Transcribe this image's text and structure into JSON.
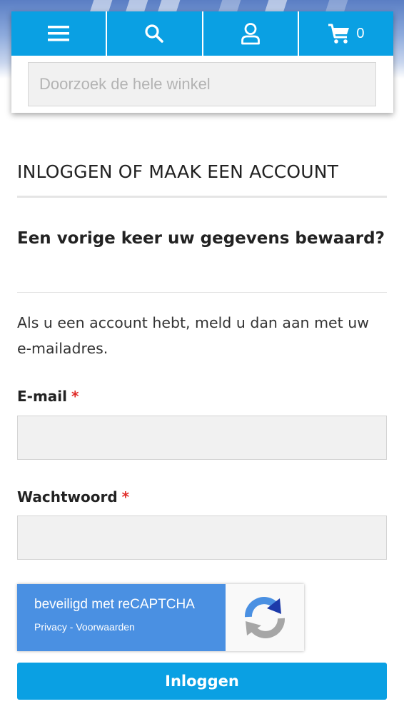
{
  "header": {
    "menu_icon": "hamburger-menu-icon",
    "search_icon": "search-icon",
    "account_icon": "user-icon",
    "cart_icon": "shopping-cart-icon",
    "cart_count": "0",
    "search_placeholder": "Doorzoek de hele winkel"
  },
  "main": {
    "page_title": "INLOGGEN OF MAAK EEN ACCOUNT",
    "section_heading": "Een vorige keer uw gegevens bewaard?",
    "intro_text": "Als u een account hebt, meld u dan aan met uw e-mailadres.",
    "email_label": "E-mail",
    "password_label": "Wachtwoord",
    "required_marker": "*",
    "login_button": "Inloggen"
  },
  "recaptcha": {
    "title": "beveiligd met reCAPTCHA",
    "links": "Privacy - Voorwaarden"
  },
  "colors": {
    "accent": "#0aa0e3",
    "required": "#e02b27",
    "recaptcha_blue": "#4a90e2"
  }
}
